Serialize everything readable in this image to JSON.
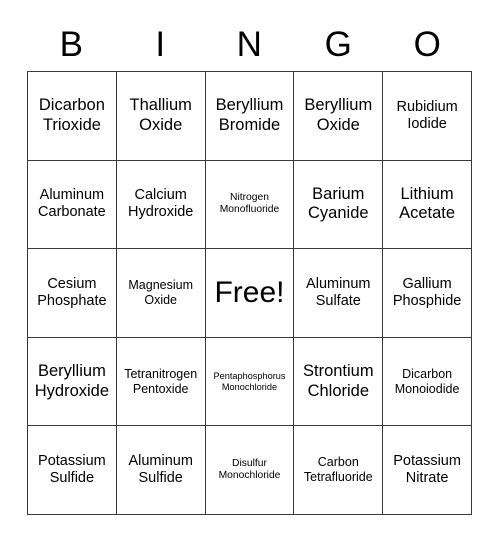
{
  "header": {
    "letters": [
      "B",
      "I",
      "N",
      "G",
      "O"
    ]
  },
  "grid": {
    "rows": 5,
    "columns": 5,
    "border_color": "#3a3a3a",
    "background_color": "#ffffff",
    "text_color": "#000000",
    "cells": [
      {
        "text": "Dicarbon Trioxide",
        "size": "lg",
        "free": false
      },
      {
        "text": "Thallium Oxide",
        "size": "lg",
        "free": false
      },
      {
        "text": "Beryllium Bromide",
        "size": "lg",
        "free": false
      },
      {
        "text": "Beryllium Oxide",
        "size": "lg",
        "free": false
      },
      {
        "text": "Rubidium Iodide",
        "size": "md",
        "free": false
      },
      {
        "text": "Aluminum Carbonate",
        "size": "md",
        "free": false
      },
      {
        "text": "Calcium Hydroxide",
        "size": "md",
        "free": false
      },
      {
        "text": "Nitrogen Monofluoride",
        "size": "xs",
        "free": false
      },
      {
        "text": "Barium Cyanide",
        "size": "lg",
        "free": false
      },
      {
        "text": "Lithium Acetate",
        "size": "lg",
        "free": false
      },
      {
        "text": "Cesium Phosphate",
        "size": "md",
        "free": false
      },
      {
        "text": "Magnesium Oxide",
        "size": "sm",
        "free": false
      },
      {
        "text": "Free!",
        "size": "xl",
        "free": true
      },
      {
        "text": "Aluminum Sulfate",
        "size": "md",
        "free": false
      },
      {
        "text": "Gallium Phosphide",
        "size": "md",
        "free": false
      },
      {
        "text": "Beryllium Hydroxide",
        "size": "lg",
        "free": false
      },
      {
        "text": "Tetranitrogen Pentoxide",
        "size": "sm",
        "free": false
      },
      {
        "text": "Pentaphosphorus Monochloride",
        "size": "xxs",
        "free": false
      },
      {
        "text": "Strontium Chloride",
        "size": "lg",
        "free": false
      },
      {
        "text": "Dicarbon Monoiodide",
        "size": "sm",
        "free": false
      },
      {
        "text": "Potassium Sulfide",
        "size": "md",
        "free": false
      },
      {
        "text": "Aluminum Sulfide",
        "size": "md",
        "free": false
      },
      {
        "text": "Disulfur Monochloride",
        "size": "xs",
        "free": false
      },
      {
        "text": "Carbon Tetrafluoride",
        "size": "sm",
        "free": false
      },
      {
        "text": "Potassium Nitrate",
        "size": "md",
        "free": false
      }
    ]
  }
}
